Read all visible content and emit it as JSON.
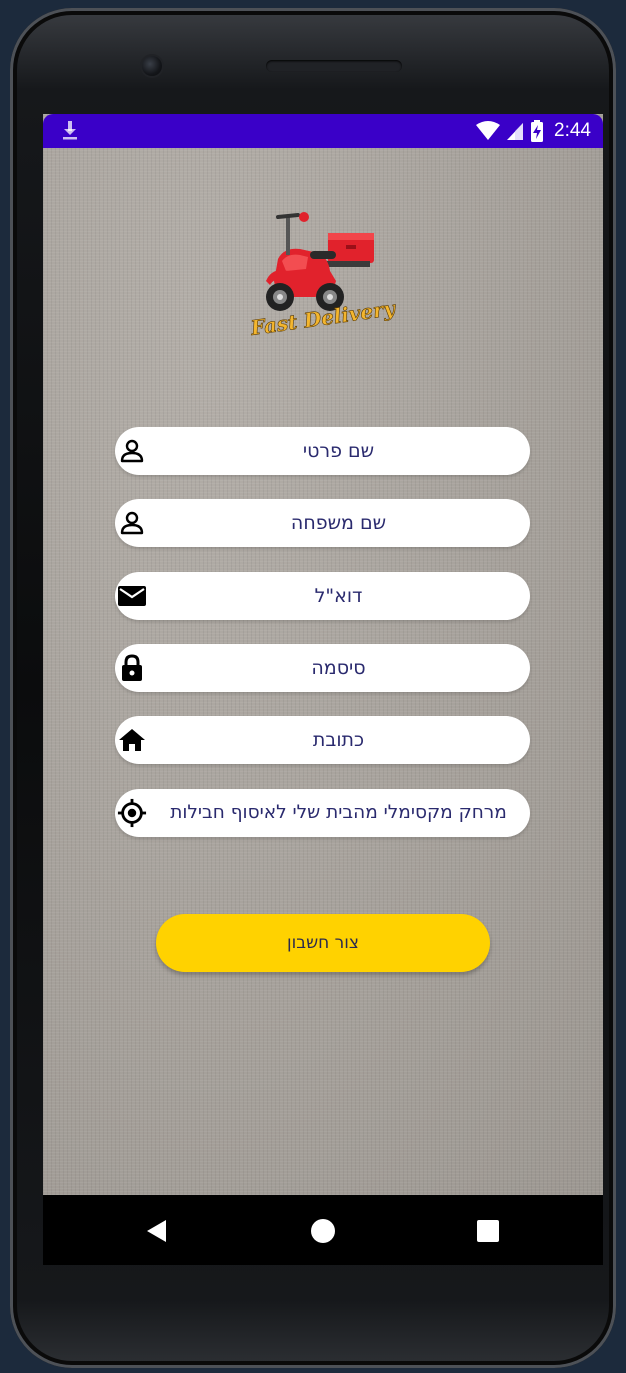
{
  "status_bar": {
    "time": "2:44",
    "icons": [
      "download-icon",
      "wifi-icon",
      "cellular-signal-icon",
      "battery-charging-icon"
    ]
  },
  "app": {
    "logo_text": "Fast Delivery",
    "logo_icon": "scooter-icon"
  },
  "form": {
    "fields": [
      {
        "placeholder": "שם פרטי",
        "icon": "person-icon"
      },
      {
        "placeholder": "שם משפחה",
        "icon": "person-icon"
      },
      {
        "placeholder": "דוא\"ל",
        "icon": "email-icon"
      },
      {
        "placeholder": "סיסמה",
        "icon": "lock-icon"
      },
      {
        "placeholder": "כתובת",
        "icon": "home-icon"
      },
      {
        "placeholder": "מרחק מקסימלי מהבית שלי לאיסוף חבילות",
        "icon": "gps-target-icon"
      }
    ],
    "submit_label": "צור חשבון"
  },
  "nav_bar": {
    "icons": [
      "back-icon",
      "home-icon",
      "recents-icon"
    ]
  },
  "colors": {
    "status_bar": "#3a00c8",
    "button": "#ffd200",
    "field_text": "#2a2a6e"
  }
}
